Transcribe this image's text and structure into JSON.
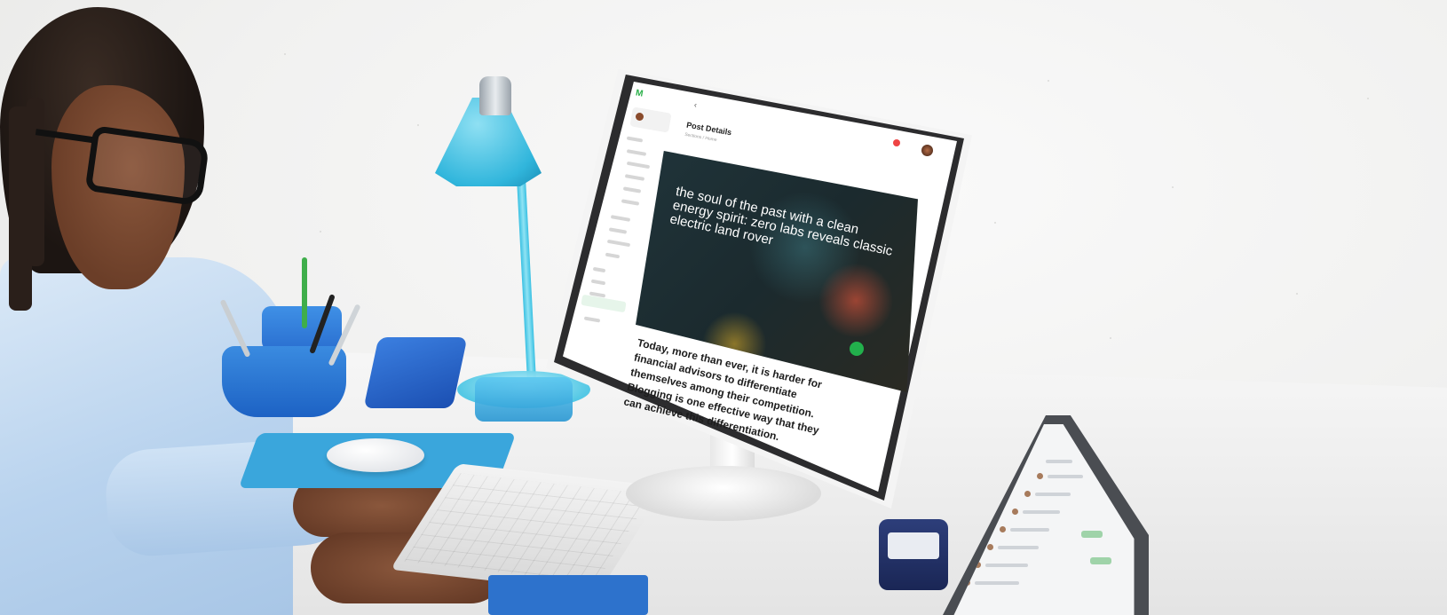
{
  "screen": {
    "app_title": "Post Details",
    "breadcrumb": "Sections / Home",
    "hero": {
      "headline": "the soul of the past with a clean energy spirit: zero labs reveals classic electric land rover"
    },
    "article": {
      "lead": "Today, more than ever, it is harder for financial advisors to differentiate themselves among their competition. Blogging is one effective way that they can achieve this differentiation."
    },
    "icons": {
      "back": "back-arrow-icon",
      "notification": "bell-icon",
      "fab": "logo-fab-icon"
    }
  },
  "colors": {
    "brand_green": "#2bb04a",
    "lamp_blue": "#31b6dc",
    "desk_blue": "#1d62c4"
  }
}
